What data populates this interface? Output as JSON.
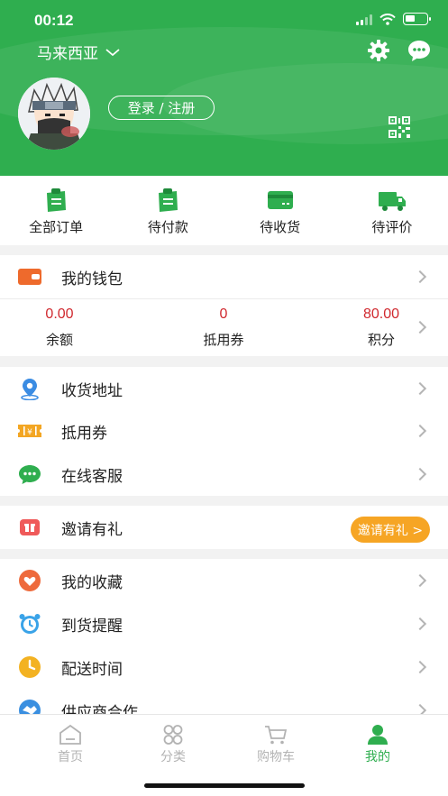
{
  "status": {
    "time": "00:12"
  },
  "header": {
    "region": "马来西亚",
    "login_label": "登录 / 注册",
    "icons": [
      "chevron-down-icon",
      "gear-icon",
      "chat-icon",
      "qr-code-icon"
    ]
  },
  "orders": [
    {
      "label": "全部订单",
      "icon": "all-orders-icon"
    },
    {
      "label": "待付款",
      "icon": "pending-payment-icon"
    },
    {
      "label": "待收货",
      "icon": "pending-receipt-icon"
    },
    {
      "label": "待评价",
      "icon": "pending-review-icon"
    }
  ],
  "wallet": {
    "title": "我的钱包",
    "balance": {
      "value": "0.00",
      "label": "余额"
    },
    "coupons": {
      "value": "0",
      "label": "抵用券"
    },
    "points": {
      "value": "80.00",
      "label": "积分"
    }
  },
  "services": [
    {
      "label": "收货地址",
      "icon": "location-icon"
    },
    {
      "label": "抵用券",
      "icon": "coupon-icon"
    },
    {
      "label": "在线客服",
      "icon": "customer-service-icon"
    }
  ],
  "invite": {
    "label": "邀请有礼",
    "badge": "邀请有礼 >"
  },
  "more": [
    {
      "label": "我的收藏",
      "icon": "heart-icon"
    },
    {
      "label": "到货提醒",
      "icon": "alarm-clock-icon"
    },
    {
      "label": "配送时间",
      "icon": "clock-icon"
    },
    {
      "label": "供应商合作",
      "icon": "handshake-icon"
    }
  ],
  "tabs": [
    {
      "label": "首页",
      "icon": "home-icon"
    },
    {
      "label": "分类",
      "icon": "category-icon"
    },
    {
      "label": "购物车",
      "icon": "cart-icon"
    },
    {
      "label": "我的",
      "icon": "profile-icon"
    }
  ],
  "colors": {
    "brand_green": "#2fae4f",
    "price_red": "#d0282e",
    "invite_orange": "#f6a524"
  }
}
